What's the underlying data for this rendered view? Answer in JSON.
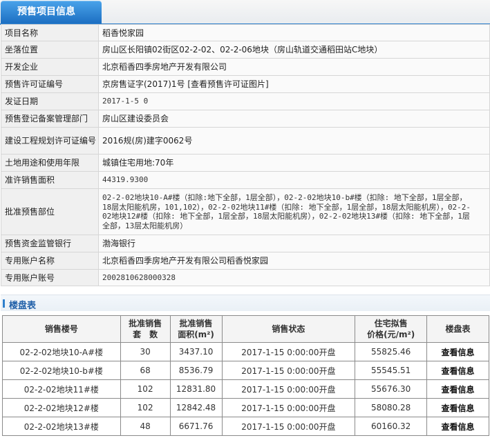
{
  "header": {
    "tab_title": "预售项目信息"
  },
  "info": {
    "rows": [
      {
        "label": "项目名称",
        "value": "稻香悦家园"
      },
      {
        "label": "坐落位置",
        "value": "房山区长阳镇02街区02-2-02、02-2-06地块（房山轨道交通稻田站C地块）"
      },
      {
        "label": "开发企业",
        "value": "北京稻香四季房地产开发有限公司"
      },
      {
        "label": "预售许可证编号",
        "value": "京房售证字(2017)1号",
        "link": "[查看预售许可证图片]"
      },
      {
        "label": "发证日期",
        "value": "2017-1-5 0"
      },
      {
        "label": "预售登记备案管理部门",
        "value": "房山区建设委员会"
      },
      {
        "label": "建设工程规划许可证编号",
        "value": "2016规(房)建字0062号"
      },
      {
        "label": "土地用途和使用年限",
        "value": "城镇住宅用地:70年"
      },
      {
        "label": "准许销售面积",
        "value": "44319.9300"
      },
      {
        "label": "批准预售部位",
        "value": "02-2-02地块10-A#楼（扣除:地下全部，1层全部），02-2-02地块10-b#楼（扣除: 地下全部，1层全部，18层太阳能机房，101,102），02-2-02地块11#楼（扣除: 地下全部，1层全部，18层太阳能机房），02-2-02地块12#楼（扣除: 地下全部，1层全部，18层太阳能机房），02-2-02地块13#楼（扣除: 地下全部，1层全部，13层太阳能机房）"
      },
      {
        "label": "预售资金监管银行",
        "value": "渤海银行"
      },
      {
        "label": "专用账户名称",
        "value": "北京稻香四季房地产开发有限公司稻香悦家园"
      },
      {
        "label": "专用账户账号",
        "value": "2002810628000328"
      }
    ]
  },
  "listing": {
    "title": "楼盘表",
    "headers": {
      "building": "销售楼号",
      "units_1": "批准销售",
      "units_2": "套　数",
      "area_1": "批准销售",
      "area_2": "面积(m²)",
      "status": "销售状态",
      "price_1": "住宅拟售",
      "price_2": "价格(元/m²)",
      "table": "楼盘表"
    },
    "rows": [
      {
        "building": "02-2-02地块10-A#楼",
        "units": "30",
        "area": "3437.10",
        "status": "2017-1-15 0:00:00开盘",
        "price": "55825.46",
        "action": "查看信息"
      },
      {
        "building": "02-2-02地块10-b#楼",
        "units": "68",
        "area": "8536.79",
        "status": "2017-1-15 0:00:00开盘",
        "price": "55545.51",
        "action": "查看信息"
      },
      {
        "building": "02-2-02地块11#楼",
        "units": "102",
        "area": "12831.80",
        "status": "2017-1-15 0:00:00开盘",
        "price": "55676.30",
        "action": "查看信息"
      },
      {
        "building": "02-2-02地块12#楼",
        "units": "102",
        "area": "12842.48",
        "status": "2017-1-15 0:00:00开盘",
        "price": "58080.28",
        "action": "查看信息"
      },
      {
        "building": "02-2-02地块13#楼",
        "units": "48",
        "area": "6671.76",
        "status": "2017-1-15 0:00:00开盘",
        "price": "60160.32",
        "action": "查看信息"
      }
    ]
  }
}
